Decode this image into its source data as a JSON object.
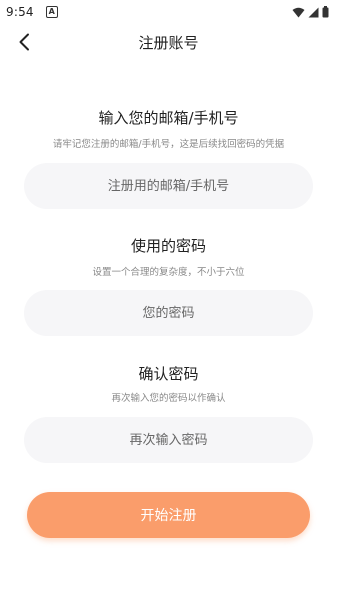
{
  "status_bar": {
    "time": "9:54",
    "notif_letter": "A"
  },
  "nav": {
    "title": "注册账号"
  },
  "account": {
    "title": "输入您的邮箱/手机号",
    "hint": "请牢记您注册的邮箱/手机号，这是后续找回密码的凭据",
    "placeholder": "注册用的邮箱/手机号"
  },
  "password": {
    "title": "使用的密码",
    "hint": "设置一个合理的复杂度，不小于六位",
    "placeholder": "您的密码"
  },
  "confirm": {
    "title": "确认密码",
    "hint": "再次输入您的密码以作确认",
    "placeholder": "再次输入密码"
  },
  "submit": {
    "label": "开始注册",
    "color": "#fa9d6b"
  }
}
